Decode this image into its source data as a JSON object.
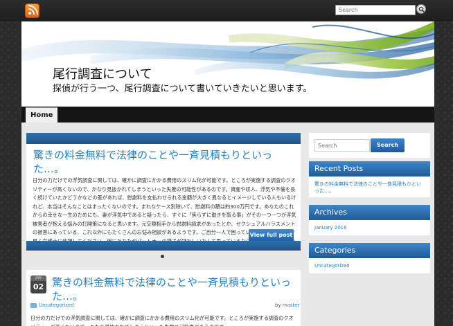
{
  "topbar": {
    "rss_icon": "rss-icon",
    "search_placeholder": "Search",
    "search_icon": "magnifier-icon"
  },
  "header": {
    "title": "尾行調査について",
    "description": "探偵が行う一つ、尾行調査について書いていきたいと思います。"
  },
  "nav": {
    "items": [
      {
        "label": "Home"
      }
    ]
  },
  "slider": {
    "title": "驚きの料金無料で法律のことや一斉見積もりといった…。",
    "text": "日分の力だけでの浮気調査に関しては、確かに調査にかかる費用のスリム化が可能です。ところが実施する調査のクオリティーが高くないので、かなり見抜かれてしまうといった失敗の可能性があるのです。資産や収入、浮気や不倫を長く続けていたかどうかなどの差があれば、慰謝料を支払わせられる金額が大きく異なるとイメージしている人もいるけれど、本当はそんなことはまったくないのです。まれなケース別除いて、慰謝料の額は約300万円です。あなたのこれからの幸せな一生のためにも、妻が浮気中であると疑ったら、すぐに「焦らずに動きを取る事」がその一つ一つが浮気被害者が抱える悩みの打開策になると思います。元交際相手から慰謝料請求があったとか、セクシュアルハラスメントの被害にあっている、これ以外にもたくさんのお悩み相談があるようです。ご自分一人で困っていないで、できるだけ早く弁護士に依頼してください。例にあなたがパートナーの様子が疑わしいなんて思っているなら、至急浮気の証拠を探し出して、「本当に浮気しているのかどうか！？」ハッキリさせましょう。いろいろ考え込んでいるばかりでは、物事を進",
    "button_label": "View full post"
  },
  "post": {
    "month": "JAN",
    "day": "02",
    "title": "驚きの料金無料で法律のことや一斉見積もりといった…。",
    "category": "Uncategorized",
    "by_label": "by",
    "author": "master",
    "excerpt": "日分の力だけでの浮気調査に関しては、確かに調査にかかる費用のスリム化が可能です。ところが実施する調査のクオリティーが高くないので、かなり見抜かれてしまうといった失敗の可能性があるのです。"
  },
  "sidebar": {
    "search_placeholder": "Search",
    "search_button": "Search",
    "recent_posts": {
      "heading": "Recent Posts",
      "items": [
        "驚きの料金無料で法律のことや一斉見積もりといった…。"
      ]
    },
    "archives": {
      "heading": "Archives",
      "items": [
        "January 2016"
      ]
    },
    "categories": {
      "heading": "Categories",
      "items": [
        "Uncategorized"
      ]
    }
  },
  "colors": {
    "accent": "#2a7fbe",
    "bar_blue": "#20548a",
    "background": "#2b2b2b"
  }
}
